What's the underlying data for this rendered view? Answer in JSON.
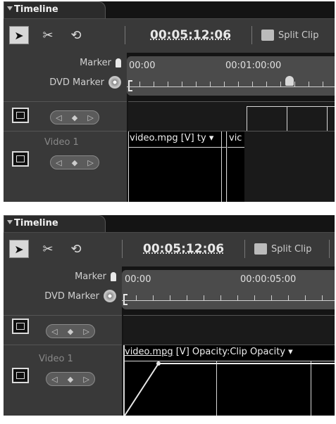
{
  "panels": [
    {
      "tab_title": "Timeline",
      "timecode": "00:05:12:06",
      "split_clip_label": "Split Clip",
      "marker_label": "Marker",
      "dvd_marker_label": "DVD Marker",
      "ruler_start": "00:00",
      "ruler_mark": "00:01:00:00",
      "track_name": "Video 1",
      "clip_label_main": "video.mpg [V]",
      "clip_label_suffix": "ty",
      "clip_label_second": "vic"
    },
    {
      "tab_title": "Timeline",
      "timecode": "00:05:12:06",
      "split_clip_label": "Split Clip",
      "marker_label": "Marker",
      "dvd_marker_label": "DVD Marker",
      "ruler_start": "00:00",
      "ruler_mark": "00:00:05:00",
      "track_name": "Video 1",
      "clip_label_main": "video.mpg",
      "clip_label_rest": "[V] Opacity:Clip Opacity"
    }
  ],
  "icons": {
    "selection_tool": "arrow-pointer-icon",
    "razor_tool": "razor-icon",
    "ripple_tool": "ripple-edit-icon",
    "split_clip": "split-clip-icon",
    "marker": "marker-icon",
    "dvd_marker": "dvd-disc-icon",
    "track_toggle": "film-frame-icon",
    "keyframe_nav": "keyframe-navigator-icon"
  },
  "colors": {
    "panel_bg": "#141414",
    "toolbar_bg": "#393939",
    "ruler_bg": "#4b4b4b",
    "text": "#e0e0e0"
  }
}
